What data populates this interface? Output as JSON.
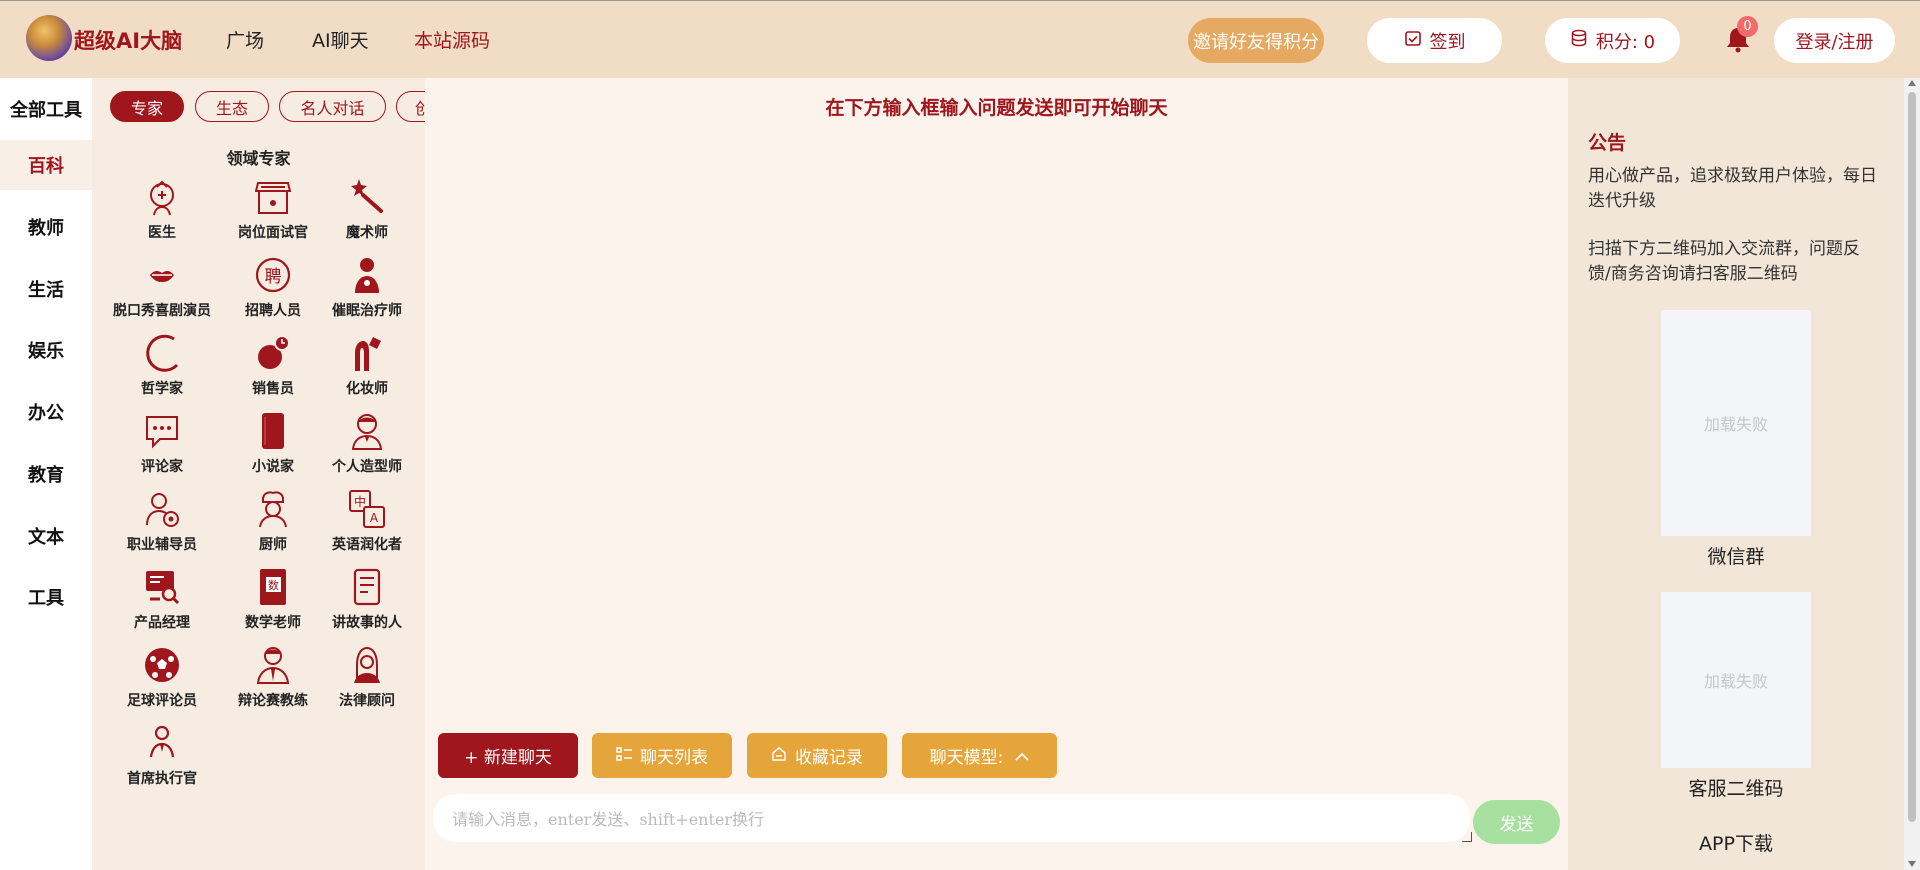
{
  "header": {
    "brand": "超级AI大脑",
    "nav": [
      "广场",
      "AI聊天",
      "本站源码"
    ],
    "invite_label": "邀请好友得积分",
    "signin_label": "签到",
    "points_label": "积分: 0",
    "notification_count": "0",
    "login_label": "登录/注册"
  },
  "categories": {
    "all_label": "全部工具",
    "items": [
      "百科",
      "教师",
      "生活",
      "娱乐",
      "办公",
      "教育",
      "文本",
      "工具"
    ]
  },
  "toolpanel": {
    "tabs": [
      "专家",
      "生态",
      "名人对话",
      "创"
    ],
    "section_title": "领域专家",
    "tools": [
      {
        "label": "医生",
        "icon": "doctor-icon"
      },
      {
        "label": "岗位面试官",
        "icon": "shop-icon"
      },
      {
        "label": "魔术师",
        "icon": "magic-wand-icon"
      },
      {
        "label": "脱口秀喜剧演员",
        "icon": "lips-icon"
      },
      {
        "label": "招聘人员",
        "icon": "hire-icon"
      },
      {
        "label": "催眠治疗师",
        "icon": "hypnotist-icon"
      },
      {
        "label": "哲学家",
        "icon": "crescent-icon"
      },
      {
        "label": "销售员",
        "icon": "sales-icon"
      },
      {
        "label": "化妆师",
        "icon": "makeup-icon"
      },
      {
        "label": "评论家",
        "icon": "comment-icon"
      },
      {
        "label": "小说家",
        "icon": "book-icon"
      },
      {
        "label": "个人造型师",
        "icon": "stylist-icon"
      },
      {
        "label": "职业辅导员",
        "icon": "career-icon"
      },
      {
        "label": "厨师",
        "icon": "chef-icon"
      },
      {
        "label": "英语润化者",
        "icon": "translate-icon"
      },
      {
        "label": "产品经理",
        "icon": "product-icon"
      },
      {
        "label": "数学老师",
        "icon": "math-book-icon"
      },
      {
        "label": "讲故事的人",
        "icon": "document-icon"
      },
      {
        "label": "足球评论员",
        "icon": "football-icon"
      },
      {
        "label": "辩论赛教练",
        "icon": "debate-icon"
      },
      {
        "label": "法律顾问",
        "icon": "lawyer-icon"
      },
      {
        "label": "首席执行官",
        "icon": "ceo-icon"
      }
    ]
  },
  "chat": {
    "hint": "在下方输入框输入问题发送即可开始聊天",
    "new_chat_label": "+ 新建聊天",
    "chat_list_label": "聊天列表",
    "favorites_label": "收藏记录",
    "model_label": "聊天模型:",
    "input_placeholder": "请输入消息，enter发送、shift+enter换行",
    "send_label": "发送"
  },
  "announcement": {
    "title": "公告",
    "text1": "用心做产品，追求极致用户体验，每日迭代升级",
    "text2": "扫描下方二维码加入交流群，问题反馈/商务咨询请扫客服二维码",
    "qr_failed": "加载失败",
    "wechat_group": "微信群",
    "service_qr": "客服二维码",
    "app_download": "APP下载"
  },
  "colors": {
    "brand_red": "#a0161d",
    "gold": "#e6a53a",
    "send_green": "#a8e09f"
  }
}
